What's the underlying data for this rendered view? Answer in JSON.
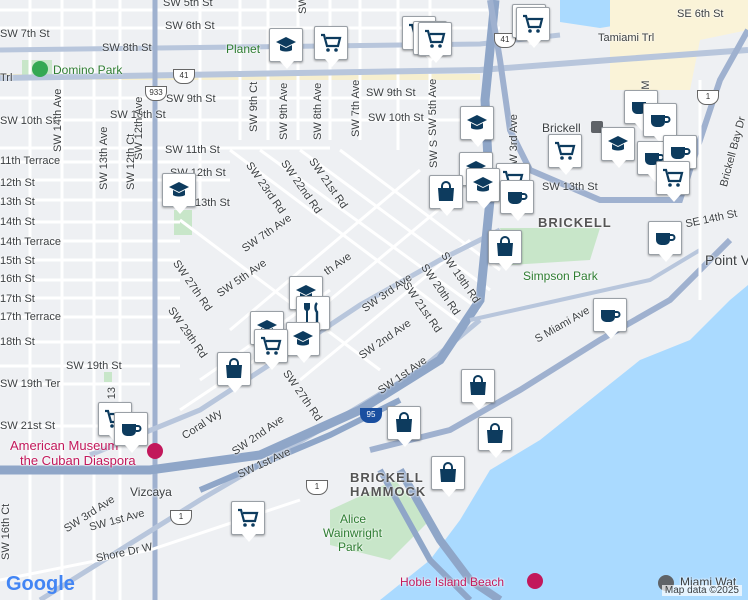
{
  "streets": {
    "sw_5th_st": "SW 5th St",
    "sw_6th_st": "SW 6th St",
    "sw_7th_st": "SW 7th St",
    "sw_8th_st": "SW 8th St",
    "sw_9th_st_a": "SW 9th St",
    "sw_9th_st_b": "SW 9th St",
    "sw_10th_st_a": "SW 10th St",
    "sw_10th_st_b": "SW 10th St",
    "sw_10th_st_c": "SW 10th St",
    "sw_11th_st": "SW 11th St",
    "sw_11th_terrace": "11th Terrace",
    "sw_12th_st_a": "12th St",
    "sw_12th_st_b": "SW 12th St",
    "sw_13th_st_a": "13th St",
    "sw_13th_st_b": "SW 13th St",
    "sw_13th_st_c": "13th St",
    "sw_14th_st": "14th St",
    "sw_14th_terrace": "14th Terrace",
    "sw_15th_st": "15th St",
    "sw_16th_st": "16th St",
    "sw_17th_st": "17th St",
    "sw_17th_terrace": "17th Terrace",
    "sw_18th_st": "18th St",
    "sw_19th_st": "SW 19th St",
    "sw_19th_ter": "SW 19th Ter",
    "sw_21st_st": "SW 21st St",
    "se_6th_st": "SE 6th St",
    "se_14th_st": "SE 14th St",
    "tamiami_trl": "Tamiami Trl",
    "sw_14th_ave": "SW 14th Ave",
    "sw_13th_ave": "SW 13th Ave",
    "sw_12th_ct": "SW 12th Ct",
    "sw_12th_ave": "SW 12th Ave",
    "sw_9th_ct": "SW 9th Ct",
    "sw_9th_ave": "SW 9th Ave",
    "sw_8th_ave": "SW 8th Ave",
    "sw_7th_ave_a": "SW 7th Ave",
    "sw_7th_ave_b": "SW 7th Ave",
    "sw_5th_ave_a": "SW 5th Ave",
    "sw_5th_ave_b": "SW 5th Ave",
    "sw_3rd_ave_a": "SW 3rd Ave",
    "sw_3rd_ave_b": "SW 3rd Ave",
    "sw_3rd_ave_c": "SW 3rd Ave",
    "sw_2nd_ave_a": "SW 2nd Ave",
    "sw_2nd_ave_b": "SW 2nd Ave",
    "sw_1st_ave_a": "SW 1st Ave",
    "sw_1st_ave_b": "SW 1st Ave",
    "sw_1st_ave_c": "SW 1st Ave",
    "sw_23rd_rd": "SW 23rd Rd",
    "sw_22nd_rd": "SW 22nd Rd",
    "sw_21st_rd_a": "SW 21st Rd",
    "sw_21st_rd_b": "SW 21st Rd",
    "sw_20th_rd": "SW 20th Rd",
    "sw_19th_rd": "SW 19th Rd",
    "sw_27th_rd_a": "SW 27th Rd",
    "sw_27th_rd_b": "SW 27th Rd",
    "sw_29th_rd": "SW 29th Rd",
    "sw_16th_ct": "SW 16th Ct",
    "coral_wy": "Coral Wy",
    "s_miami_ave": "S Miami Ave",
    "shore_dr_w": "Shore Dr W",
    "brickell_bay_dr": "Brickell Bay Dr",
    "th_ave": "th Ave",
    "sw_s": "SW S",
    "s_m": "S M",
    "sw_13": "SW 13",
    "trl": "Trl",
    "s_frag": "S",
    "sw_2_frag": "SW 2"
  },
  "places": {
    "domino_park": "Domino Park",
    "planet": "Planet",
    "brickell_station": "Brickell",
    "brickell_area": "BRICKELL",
    "brickell_hammock_1": "BRICKELL",
    "brickell_hammock_2": "HAMMOCK",
    "simpson_park": "Simpson Park",
    "american_museum_1": "American Museum",
    "american_museum_2": "the Cuban Diaspora",
    "vizcaya": "Vizcaya",
    "alice_wainwright_1": "Alice",
    "alice_wainwright_2": "Wainwright",
    "alice_wainwright_3": "Park",
    "hobie_island": "Hobie Island Beach",
    "point_view": "Point V",
    "miami_water": "Miami Wat"
  },
  "shields": {
    "us41_a": "41",
    "us41_b": "41",
    "route933": "933",
    "us1_a": "1",
    "us1_b": "1",
    "us1_c": "1",
    "i95": "95"
  },
  "markers": [
    {
      "type": "cart-icon"
    },
    {
      "type": "school-icon"
    },
    {
      "type": "cart-icon"
    },
    {
      "type": "cart-icon"
    },
    {
      "type": "cart-icon"
    },
    {
      "type": "cart-icon"
    },
    {
      "type": "cart-icon"
    },
    {
      "type": "cart-icon"
    },
    {
      "type": "coffee-icon"
    },
    {
      "type": "coffee-icon"
    },
    {
      "type": "school-icon"
    },
    {
      "type": "cart-icon"
    },
    {
      "type": "school-icon"
    },
    {
      "type": "coffee-icon"
    },
    {
      "type": "coffee-icon"
    },
    {
      "type": "cart-icon"
    },
    {
      "type": "school-icon"
    },
    {
      "type": "cart-icon"
    },
    {
      "type": "school-icon"
    },
    {
      "type": "shopping-bag-icon"
    },
    {
      "type": "school-icon"
    },
    {
      "type": "coffee-icon"
    },
    {
      "type": "shopping-bag-icon"
    },
    {
      "type": "coffee-icon"
    },
    {
      "type": "coffee-icon"
    },
    {
      "type": "school-icon"
    },
    {
      "type": "restaurant-icon"
    },
    {
      "type": "school-icon"
    },
    {
      "type": "school-icon"
    },
    {
      "type": "shopping-bag-icon"
    },
    {
      "type": "shopping-bag-icon"
    },
    {
      "type": "cart-icon"
    },
    {
      "type": "coffee-icon"
    },
    {
      "type": "shopping-bag-icon"
    },
    {
      "type": "shopping-bag-icon"
    },
    {
      "type": "shopping-bag-icon"
    },
    {
      "type": "cart-icon"
    }
  ],
  "footer": {
    "google": "Google",
    "map_data": "Map data ©2025"
  },
  "colors": {
    "marker_icon": "#0d3b5e",
    "water": "#aadaff",
    "park": "#c8e6c9",
    "highway": "#8fa6c8",
    "arterial": "#ffffff"
  }
}
